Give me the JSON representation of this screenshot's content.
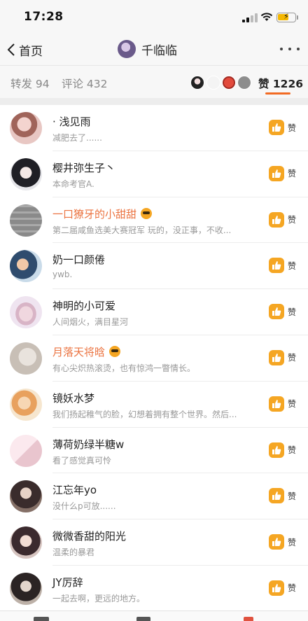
{
  "status_bar": {
    "time": "17:28"
  },
  "nav": {
    "back_label": "首页",
    "title": "千临临"
  },
  "tabs": {
    "repost": "转发 94",
    "comment": "评论 432",
    "like": "赞 1226"
  },
  "like_button_label": "赞",
  "users": [
    {
      "name": "· 浅见雨",
      "bio": "减肥去了......",
      "vip": false
    },
    {
      "name": "樱井弥生子丶",
      "bio": "本命考官A.",
      "vip": false
    },
    {
      "name": "一口獠牙的小甜甜",
      "bio": "第二届咸鱼选美大赛冠军 玩的，没正事，不收...",
      "vip": true
    },
    {
      "name": "奶一口颜倦",
      "bio": "ywb.",
      "vip": false
    },
    {
      "name": "神明的小可爱",
      "bio": "人间烟火，满目星河",
      "vip": false
    },
    {
      "name": "月落天将晗",
      "bio": "有心尖炽热滚烫，也有惊鸿一瞥情长。",
      "vip": true
    },
    {
      "name": "镜妖水梦",
      "bio": "我们扬起稚气的脸，幻想着拥有整个世界。然后...",
      "vip": false
    },
    {
      "name": "薄荷奶绿半糖w",
      "bio": "看了感觉真可怜",
      "vip": false
    },
    {
      "name": "江忘年yo",
      "bio": "没什么p可放......",
      "vip": false
    },
    {
      "name": "微微香甜的阳光",
      "bio": "温柔的暴君",
      "vip": false
    },
    {
      "name": "JY厉辞",
      "bio": "一起去啊，更远的地方。",
      "vip": false
    }
  ],
  "colors": {
    "accent": "#f26b23",
    "vip_name": "#eb7340",
    "like_icon": "#f5a623"
  }
}
